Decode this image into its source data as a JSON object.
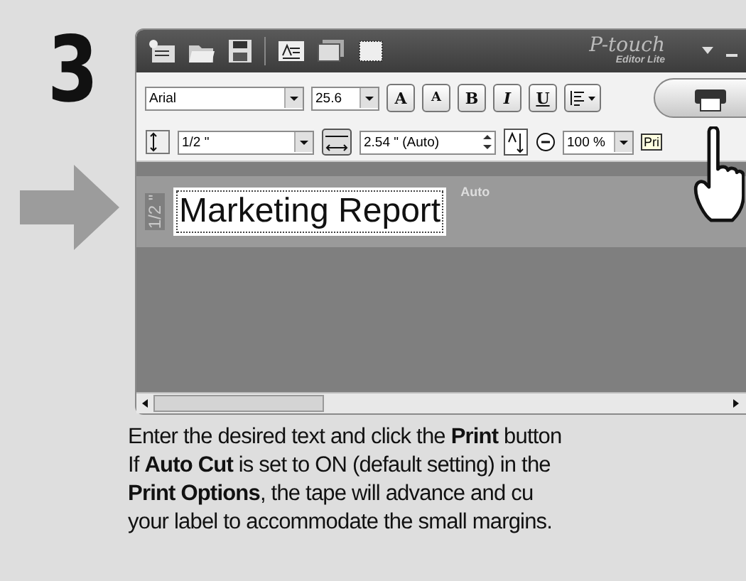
{
  "step": "3",
  "window": {
    "brand": "P-touch",
    "brand_sub": "Editor Lite"
  },
  "format_bar": {
    "font": "Arial",
    "size": "25.6",
    "grow": "A",
    "shrink": "A",
    "bold": "B",
    "italic": "I",
    "underline": "U"
  },
  "layout_bar": {
    "tape_width": "1/2 \"",
    "length": "2.54 \" (Auto)",
    "zoom": "100 %",
    "tooltip": "Pri"
  },
  "canvas": {
    "tape_label": "1/2 \"",
    "text": "Marketing Report",
    "length_mode": "Auto"
  },
  "instructions": [
    "Enter the desired text and click the **Print** button",
    "If **Auto Cut** is set to ON (default setting) in the",
    "**Print Options**, the tape will advance and cu",
    "your label to accommodate the small margins."
  ]
}
